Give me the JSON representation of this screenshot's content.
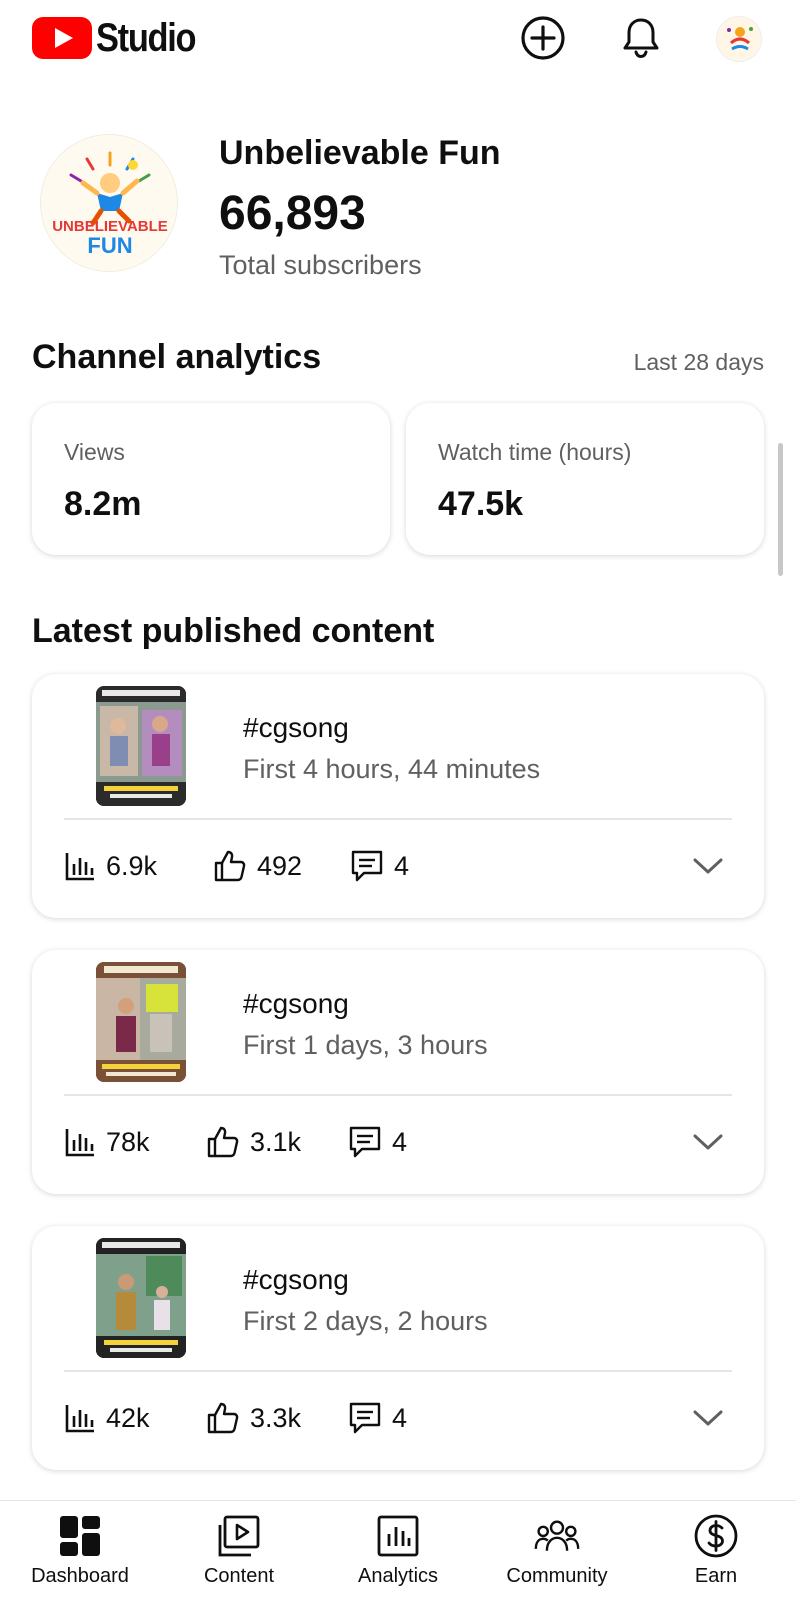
{
  "app": {
    "logo_text": "Studio"
  },
  "header": {
    "create_icon": "plus-circle-icon",
    "notifications_icon": "bell-icon",
    "account_icon": "avatar"
  },
  "channel": {
    "name": "Unbelievable Fun",
    "subscribers": "66,893",
    "subscribers_label": "Total subscribers",
    "logo_text_top": "UNBELIEVABLE",
    "logo_text_bottom": "FUN"
  },
  "analytics": {
    "title": "Channel analytics",
    "period": "Last 28 days",
    "cards": [
      {
        "label": "Views",
        "value": "8.2m"
      },
      {
        "label": "Watch time (hours)",
        "value": "47.5k"
      }
    ]
  },
  "latest": {
    "title": "Latest published content",
    "items": [
      {
        "title": "#cgsong",
        "period": "First 4 hours, 44 minutes",
        "views": "6.9k",
        "likes": "492",
        "comments": "4"
      },
      {
        "title": "#cgsong",
        "period": "First 1 days, 3 hours",
        "views": "78k",
        "likes": "3.1k",
        "comments": "4"
      },
      {
        "title": "#cgsong",
        "period": "First 2 days, 2 hours",
        "views": "42k",
        "likes": "3.3k",
        "comments": "4"
      }
    ]
  },
  "nav": [
    {
      "label": "Dashboard",
      "icon": "dashboard-icon"
    },
    {
      "label": "Content",
      "icon": "content-icon"
    },
    {
      "label": "Analytics",
      "icon": "analytics-icon"
    },
    {
      "label": "Community",
      "icon": "community-icon"
    },
    {
      "label": "Earn",
      "icon": "earn-icon"
    }
  ],
  "colors": {
    "brand_red": "#ff0000",
    "text_primary": "#0f0f0f",
    "text_secondary": "#606060"
  }
}
